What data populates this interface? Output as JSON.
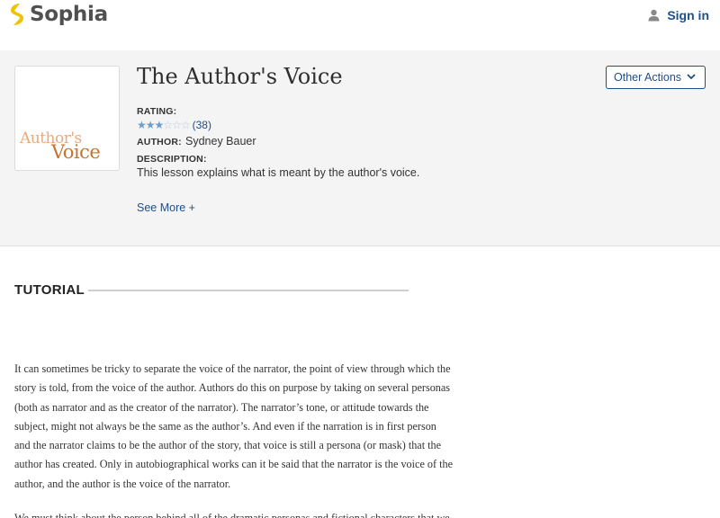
{
  "brand": {
    "name": "Sophia",
    "logo_color": "#f0c20a"
  },
  "nav": {
    "signin_label": "Sign in",
    "icon": "person-icon"
  },
  "lesson": {
    "title": "The Author's Voice",
    "thumbnail": {
      "word1": "Author's",
      "word2": "Voice"
    },
    "other_actions_label": "Other Actions",
    "rating_label": "RATING:",
    "rating_stars_filled": 3,
    "rating_stars_total": 6,
    "rating_count": "(38)",
    "author_label": "AUTHOR:",
    "author_name": "Sydney Bauer",
    "description_label": "DESCRIPTION:",
    "description": "This lesson explains what is meant by the author's voice.",
    "see_more_label": "See More +"
  },
  "tutorial": {
    "heading": "TUTORIAL",
    "paragraph1_lines": [
      "It can sometimes be tricky to separate the voice of the narrator, the point of view through which the",
      "story is told, from the voice of the author. Authors do this on purpose by taking on several personas",
      "(both as narrator and as the creator of the narrator). The narrator’s tone, or attitude towards the",
      "subject, might not always be the same as the author’s. And even if the narration is in first person",
      "and the narrator claims to be the author of the story, that voice is still a persona (or mask) that the",
      "author has created. Only in autobiographical works can it be said that the narrator is the voice of the",
      "author, and the author is the voice of the narrator."
    ],
    "paragraph2_lines": [
      "We must think about the person behind all of the dramatic personas and fictional characters that we"
    ]
  },
  "colors": {
    "link": "#1e4e8c",
    "star_filled": "#6d9bcb",
    "header_bg": "#f4f4f4"
  }
}
